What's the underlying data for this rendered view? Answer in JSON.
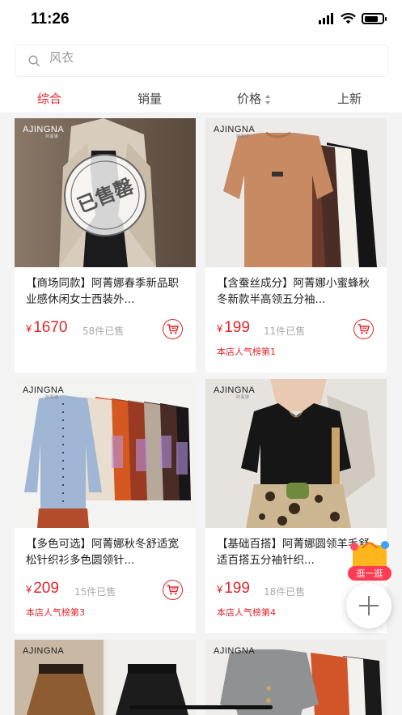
{
  "status": {
    "time": "11:26"
  },
  "search": {
    "placeholder": "风衣"
  },
  "sort": {
    "tabs": [
      {
        "label": "综合",
        "active": true
      },
      {
        "label": "销量",
        "active": false
      },
      {
        "label": "价格",
        "active": false
      },
      {
        "label": "上新",
        "active": false
      }
    ]
  },
  "brand": {
    "name": "AJINGNA",
    "sub": "阿菁娜"
  },
  "currency": "¥",
  "stamp": {
    "text": "已售罄"
  },
  "products": [
    {
      "title": "【商场同款】阿菁娜春季新品职业感休闲女士西装外...",
      "price": "1670",
      "sold": "58件已售",
      "rank": ""
    },
    {
      "title": "【含蚕丝成分】阿菁娜小蜜蜂秋冬新款半高领五分袖...",
      "price": "199",
      "sold": "11件已售",
      "rank": "本店人气榜第1"
    },
    {
      "title": "【多色可选】阿菁娜秋冬舒适宽松针织衫多色圆领针...",
      "price": "209",
      "sold": "15件已售",
      "rank": "本店人气榜第3"
    },
    {
      "title": "【基础百搭】阿菁娜圆领羊毛舒适百搭五分袖针织...",
      "price": "199",
      "sold": "18件已售",
      "rank": "本店人气榜第4"
    }
  ],
  "float": {
    "guang_label": "逛一逛"
  },
  "colors": {
    "accent": "#e0262d"
  }
}
